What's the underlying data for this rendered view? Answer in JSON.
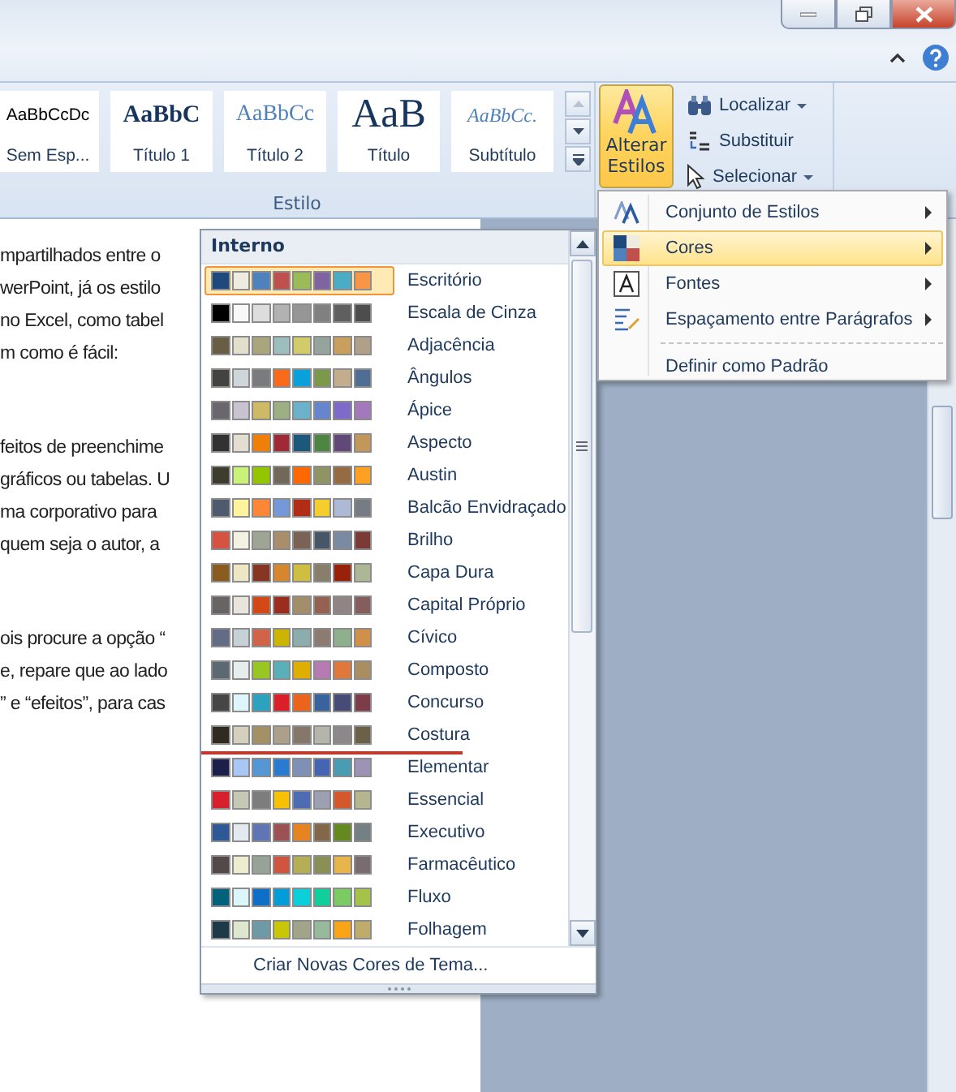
{
  "ribbon": {
    "style_gallery": [
      {
        "preview": "AaBbCcDc",
        "label": "Sem Esp...",
        "kind": "normal"
      },
      {
        "preview": "AaBbC",
        "label": "Título 1",
        "kind": "heading1"
      },
      {
        "preview": "AaBbCc",
        "label": "Título 2",
        "kind": "heading2"
      },
      {
        "preview": "AaB",
        "label": "Título",
        "kind": "title"
      },
      {
        "preview": "AaBbCc.",
        "label": "Subtítulo",
        "kind": "subtitle"
      }
    ],
    "group_label": "Estilo",
    "change_styles": {
      "line1": "Alterar",
      "line2": "Estilos",
      "selected": true
    },
    "editing": [
      {
        "label": "Localizar",
        "kind": "find",
        "dropdown": true
      },
      {
        "label": "Substituir",
        "kind": "replace",
        "dropdown": false
      },
      {
        "label": "Selecionar",
        "kind": "select",
        "dropdown": true
      }
    ]
  },
  "document": {
    "paragraphs": [
      [
        "mpartilhados entre o",
        "werPoint, já os estilo",
        "no Excel, como tabel",
        "m como é fácil:"
      ],
      [
        "feitos de preenchime",
        "gráficos ou tabelas. U",
        "ma corporativo para",
        "quem seja o autor, a"
      ],
      [
        "ois procure a opção “",
        "e, repare que ao lado",
        "” e “efeitos”, para cas"
      ]
    ]
  },
  "colors_gallery": {
    "header": "Interno",
    "footer": "Criar Novas Cores de Tema...",
    "themes": [
      {
        "name": "Escritório",
        "selected": true,
        "marked": false,
        "colors": [
          {
            "color": "#1f497d"
          },
          {
            "color": "#eeece1"
          },
          {
            "color": "#4f81bd"
          },
          {
            "color": "#c0504d"
          },
          {
            "color": "#9bbb59"
          },
          {
            "color": "#8064a2"
          },
          {
            "color": "#4bacc6"
          },
          {
            "color": "#f79646"
          }
        ]
      },
      {
        "name": "Escala de Cinza",
        "selected": false,
        "marked": false,
        "colors": [
          {
            "color": "#000000"
          },
          {
            "color": "#f8f8f8"
          },
          {
            "color": "#dddddd"
          },
          {
            "color": "#b2b2b2"
          },
          {
            "color": "#969696"
          },
          {
            "color": "#808080"
          },
          {
            "color": "#5f5f5f"
          },
          {
            "color": "#4d4d4d"
          }
        ]
      },
      {
        "name": "Adjacência",
        "selected": false,
        "marked": false,
        "colors": [
          {
            "color": "#695d46"
          },
          {
            "color": "#e2dfcc"
          },
          {
            "color": "#a9a57c"
          },
          {
            "color": "#9cbebd"
          },
          {
            "color": "#d2cb6c"
          },
          {
            "color": "#95a39d"
          },
          {
            "color": "#c89f5d"
          },
          {
            "color": "#b1a089"
          }
        ]
      },
      {
        "name": "Ângulos",
        "selected": false,
        "marked": false,
        "colors": [
          {
            "color": "#434342"
          },
          {
            "color": "#cdd7d9"
          },
          {
            "color": "#797b7e"
          },
          {
            "color": "#f96a1b"
          },
          {
            "color": "#08a1d9"
          },
          {
            "color": "#7c984a"
          },
          {
            "color": "#c2ad8d"
          },
          {
            "color": "#506e94"
          }
        ]
      },
      {
        "name": "Ápice",
        "selected": false,
        "marked": false,
        "colors": [
          {
            "color": "#69676d"
          },
          {
            "color": "#c9c2d1"
          },
          {
            "color": "#ceb966"
          },
          {
            "color": "#9cb084"
          },
          {
            "color": "#6bb1c9"
          },
          {
            "color": "#6585cf"
          },
          {
            "color": "#7e6bc9"
          },
          {
            "color": "#a379bb"
          }
        ]
      },
      {
        "name": "Aspecto",
        "selected": false,
        "marked": false,
        "colors": [
          {
            "color": "#323232"
          },
          {
            "color": "#e3ded1"
          },
          {
            "color": "#f07f09"
          },
          {
            "color": "#9f2936"
          },
          {
            "color": "#1b587c"
          },
          {
            "color": "#4e8542"
          },
          {
            "color": "#604878"
          },
          {
            "color": "#c19859"
          }
        ]
      },
      {
        "name": "Austin",
        "selected": false,
        "marked": false,
        "colors": [
          {
            "color": "#3e3d2d"
          },
          {
            "color": "#caf278"
          },
          {
            "color": "#94c600"
          },
          {
            "color": "#71685a"
          },
          {
            "color": "#ff6700"
          },
          {
            "color": "#909465"
          },
          {
            "color": "#956b43"
          },
          {
            "color": "#fea022"
          }
        ]
      },
      {
        "name": "Balcão Envidraçado",
        "selected": false,
        "marked": false,
        "colors": [
          {
            "color": "#4e5b6f"
          },
          {
            "color": "#fff39d"
          },
          {
            "color": "#fe8637"
          },
          {
            "color": "#7598d9"
          },
          {
            "color": "#b32c16"
          },
          {
            "color": "#f5cd2d"
          },
          {
            "color": "#aebad5"
          },
          {
            "color": "#777c84"
          }
        ]
      },
      {
        "name": "Brilho",
        "selected": false,
        "marked": false,
        "colors": [
          {
            "color": "#d55340"
          },
          {
            "color": "#f3f1e1"
          },
          {
            "color": "#9fa594"
          },
          {
            "color": "#a98e6b"
          },
          {
            "color": "#7a6257"
          },
          {
            "color": "#465568"
          },
          {
            "color": "#7a8aa0"
          },
          {
            "color": "#7b3a36"
          }
        ]
      },
      {
        "name": "Capa Dura",
        "selected": false,
        "marked": false,
        "colors": [
          {
            "color": "#8b5c20"
          },
          {
            "color": "#ede7c4"
          },
          {
            "color": "#873624"
          },
          {
            "color": "#d6862d"
          },
          {
            "color": "#d0be40"
          },
          {
            "color": "#877f6c"
          },
          {
            "color": "#972109"
          },
          {
            "color": "#aeb795"
          }
        ]
      },
      {
        "name": "Capital Próprio",
        "selected": false,
        "marked": false,
        "colors": [
          {
            "color": "#696464"
          },
          {
            "color": "#e9e5dc"
          },
          {
            "color": "#d34817"
          },
          {
            "color": "#9b2d1f"
          },
          {
            "color": "#a28e6a"
          },
          {
            "color": "#956251"
          },
          {
            "color": "#918485"
          },
          {
            "color": "#855d5d"
          }
        ]
      },
      {
        "name": "Cívico",
        "selected": false,
        "marked": false,
        "colors": [
          {
            "color": "#646b86"
          },
          {
            "color": "#c5d1d7"
          },
          {
            "color": "#d16349"
          },
          {
            "color": "#ccb400"
          },
          {
            "color": "#8cadae"
          },
          {
            "color": "#8c7b70"
          },
          {
            "color": "#8fb08c"
          },
          {
            "color": "#d19049"
          }
        ]
      },
      {
        "name": "Composto",
        "selected": false,
        "marked": false,
        "colors": [
          {
            "color": "#5b6973"
          },
          {
            "color": "#e7ecec"
          },
          {
            "color": "#98c723"
          },
          {
            "color": "#59b0b9"
          },
          {
            "color": "#deae00"
          },
          {
            "color": "#b77bb4"
          },
          {
            "color": "#e0773c"
          },
          {
            "color": "#a98d63"
          }
        ]
      },
      {
        "name": "Concurso",
        "selected": false,
        "marked": false,
        "colors": [
          {
            "color": "#464646"
          },
          {
            "color": "#def5fa"
          },
          {
            "color": "#2da2bf"
          },
          {
            "color": "#da1f28"
          },
          {
            "color": "#eb641b"
          },
          {
            "color": "#39639d"
          },
          {
            "color": "#474b78"
          },
          {
            "color": "#7d3c4a"
          }
        ]
      },
      {
        "name": "Costura",
        "selected": false,
        "marked": true,
        "colors": [
          {
            "color": "#2f2b20"
          },
          {
            "color": "#d5d0be"
          },
          {
            "color": "#a39165"
          },
          {
            "color": "#ada08b"
          },
          {
            "color": "#857769"
          },
          {
            "color": "#b5b5ab"
          },
          {
            "color": "#8c878b"
          },
          {
            "color": "#6b6149"
          }
        ]
      },
      {
        "name": "Elementar",
        "selected": false,
        "marked": false,
        "colors": [
          {
            "color": "#1d1f4b"
          },
          {
            "color": "#a9c6f5"
          },
          {
            "color": "#5597d4"
          },
          {
            "color": "#2a7ad0"
          },
          {
            "color": "#7e90b5"
          },
          {
            "color": "#4564b3"
          },
          {
            "color": "#4a9cb3"
          },
          {
            "color": "#9d93b4"
          }
        ]
      },
      {
        "name": "Essencial",
        "selected": false,
        "marked": false,
        "colors": [
          {
            "color": "#d8202c"
          },
          {
            "color": "#c6c7b4"
          },
          {
            "color": "#7d7d7d"
          },
          {
            "color": "#f7c000"
          },
          {
            "color": "#4e6cb4"
          },
          {
            "color": "#9d9fb3"
          },
          {
            "color": "#d5582c"
          },
          {
            "color": "#b5b58f"
          }
        ]
      },
      {
        "name": "Executivo",
        "selected": false,
        "marked": false,
        "colors": [
          {
            "color": "#2f5897"
          },
          {
            "color": "#e4e9ef"
          },
          {
            "color": "#6076b4"
          },
          {
            "color": "#9c5252"
          },
          {
            "color": "#e68422"
          },
          {
            "color": "#846648"
          },
          {
            "color": "#63891f"
          },
          {
            "color": "#758085"
          }
        ]
      },
      {
        "name": "Farmacêutico",
        "selected": false,
        "marked": false,
        "colors": [
          {
            "color": "#534949"
          },
          {
            "color": "#eeeccf"
          },
          {
            "color": "#97a397"
          },
          {
            "color": "#d05541"
          },
          {
            "color": "#b6ae57"
          },
          {
            "color": "#8a8f55"
          },
          {
            "color": "#e8b54d"
          },
          {
            "color": "#786c71"
          }
        ]
      },
      {
        "name": "Fluxo",
        "selected": false,
        "marked": false,
        "colors": [
          {
            "color": "#04617b"
          },
          {
            "color": "#dbf5f9"
          },
          {
            "color": "#0f6fc6"
          },
          {
            "color": "#009dd9"
          },
          {
            "color": "#0bd0d9"
          },
          {
            "color": "#10cf9b"
          },
          {
            "color": "#7cca62"
          },
          {
            "color": "#a5c249"
          }
        ]
      },
      {
        "name": "Folhagem",
        "selected": false,
        "marked": false,
        "colors": [
          {
            "color": "#1e3a48"
          },
          {
            "color": "#dfe6d0"
          },
          {
            "color": "#6e99a6"
          },
          {
            "color": "#c9c507"
          },
          {
            "color": "#a3a58b"
          },
          {
            "color": "#97ba9c"
          },
          {
            "color": "#f9a316"
          },
          {
            "color": "#bfac6c"
          }
        ]
      }
    ]
  },
  "change_styles_menu": [
    {
      "label": "Conjunto de Estilos",
      "selected": false,
      "submenu": true,
      "separator_before": false
    },
    {
      "label": "Cores",
      "selected": true,
      "submenu": true,
      "separator_before": false
    },
    {
      "label": "Fontes",
      "selected": false,
      "submenu": true,
      "separator_before": false
    },
    {
      "label": "Espaçamento entre Parágrafos",
      "selected": false,
      "submenu": true,
      "separator_before": false
    },
    {
      "label": "Definir como Padrão",
      "selected": false,
      "submenu": false,
      "separator_before": true
    }
  ]
}
